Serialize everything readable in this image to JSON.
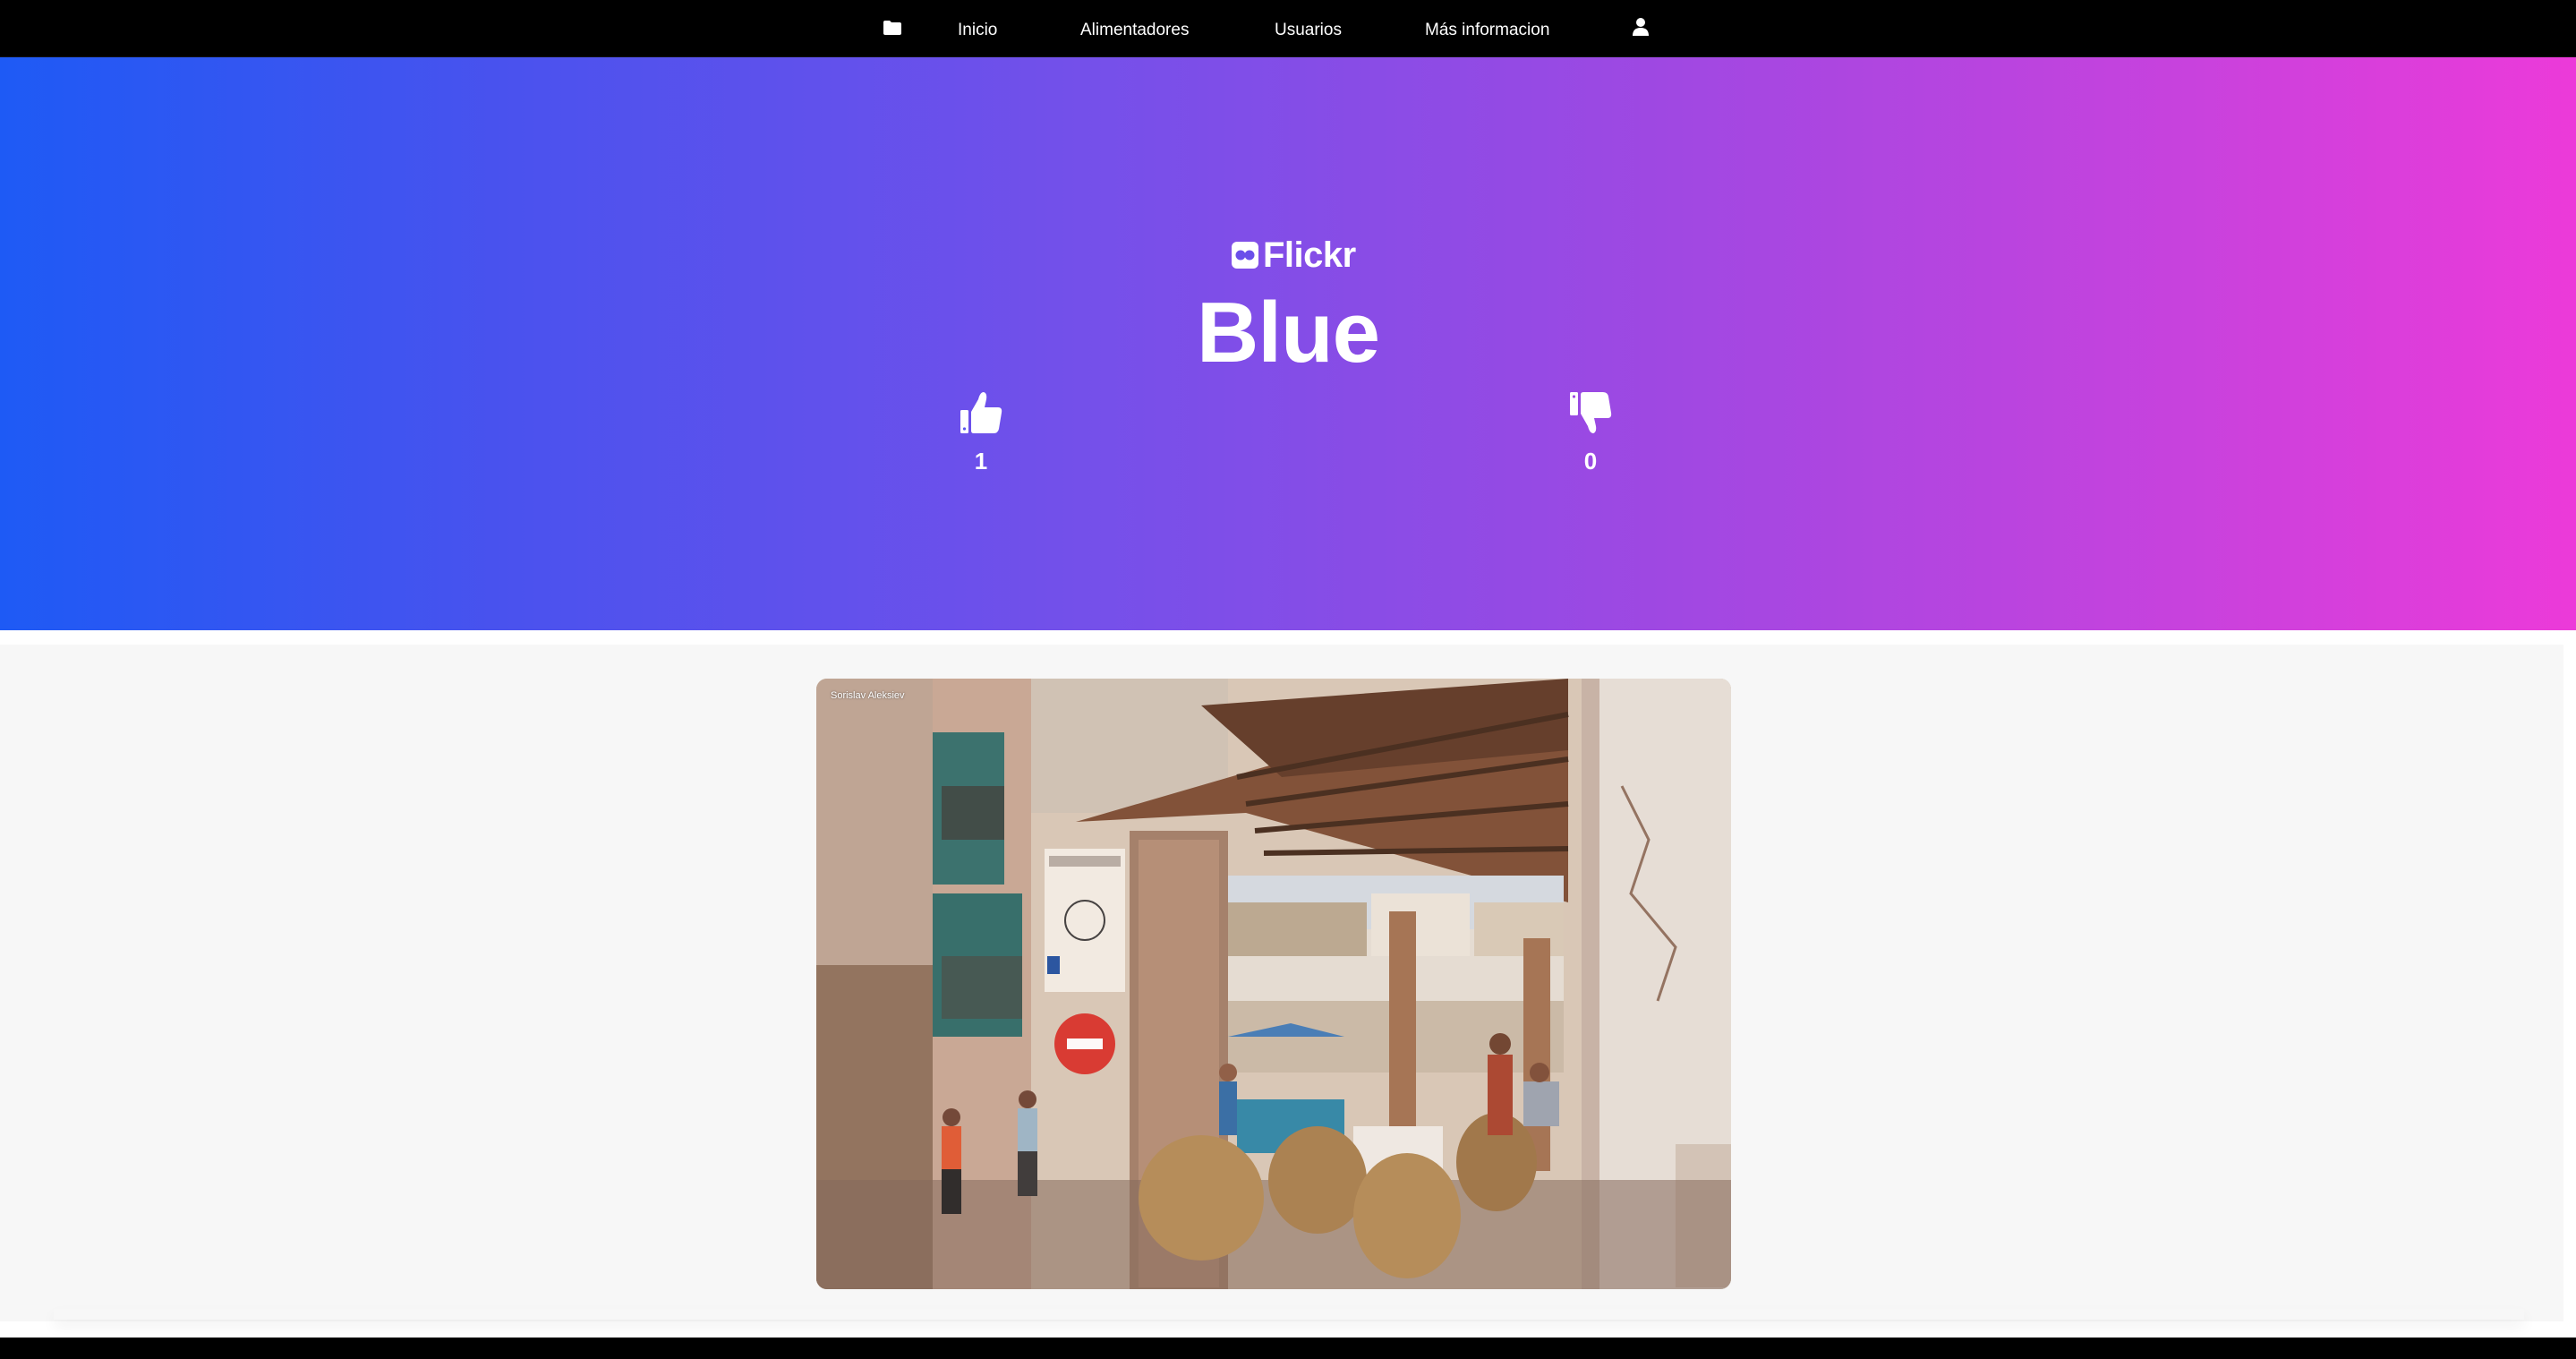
{
  "nav": {
    "folder_icon": "folder-icon",
    "links": [
      "Inicio",
      "Alimentadores",
      "Usuarios",
      "Más informacion"
    ],
    "user_icon": "user-icon"
  },
  "hero": {
    "brand_name": "Flickr",
    "title": "Blue",
    "likes": "1",
    "dislikes": "0"
  },
  "photo": {
    "author": "Sorislav Aleksiev"
  },
  "colors": {
    "gradient_start": "#1e5af5",
    "gradient_mid": "#7450ea",
    "gradient_end": "#ec3ad9",
    "nav_bg": "#000000",
    "content_bg": "#f7f7f7"
  }
}
